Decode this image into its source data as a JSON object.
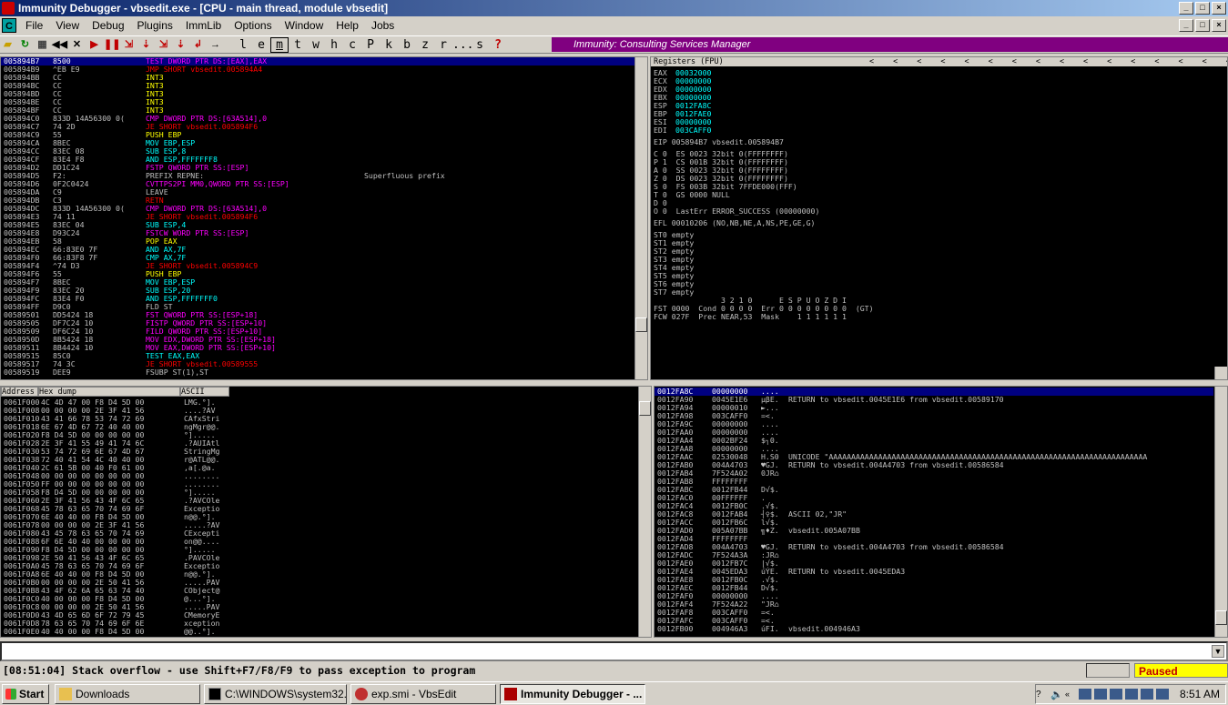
{
  "window": {
    "title": "Immunity Debugger - vbsedit.exe - [CPU - main thread, module vbsedit]"
  },
  "menu": [
    "File",
    "View",
    "Debug",
    "Plugins",
    "ImmLib",
    "Options",
    "Window",
    "Help",
    "Jobs"
  ],
  "toolbar_letters": [
    "l",
    "e",
    "m",
    "t",
    "w",
    "h",
    "c",
    "P",
    "k",
    "b",
    "z",
    "r",
    "...",
    "s",
    "?"
  ],
  "banner": "Immunity: Consulting Services Manager",
  "cpu": [
    [
      "005894B7",
      "8500",
      "TEST DWORD PTR DS:[EAX],EAX",
      "",
      1
    ],
    [
      "005894B9",
      "^EB E9",
      "JMP SHORT vbsedit.005894A4",
      "",
      0
    ],
    [
      "005894BB",
      "CC",
      "INT3",
      "",
      0
    ],
    [
      "005894BC",
      "CC",
      "INT3",
      "",
      0
    ],
    [
      "005894BD",
      "CC",
      "INT3",
      "",
      0
    ],
    [
      "005894BE",
      "CC",
      "INT3",
      "",
      0
    ],
    [
      "005894BF",
      "CC",
      "INT3",
      "",
      0
    ],
    [
      "005894C0",
      "833D 14A56300 0(",
      "CMP DWORD PTR DS:[63A514],0",
      "",
      0
    ],
    [
      "005894C7",
      "74 2D",
      "JE SHORT vbsedit.005894F6",
      "",
      0
    ],
    [
      "005894C9",
      "55",
      "PUSH EBP",
      "",
      0
    ],
    [
      "005894CA",
      "8BEC",
      "MOV EBP,ESP",
      "",
      0
    ],
    [
      "005894CC",
      "83EC 08",
      "SUB ESP,8",
      "",
      0
    ],
    [
      "005894CF",
      "83E4 F8",
      "AND ESP,FFFFFFF8",
      "",
      0
    ],
    [
      "005894D2",
      "DD1C24",
      "FSTP QWORD PTR SS:[ESP]",
      "",
      0
    ],
    [
      "005894D5",
      "F2:",
      "PREFIX REPNE:",
      "Superfluous prefix",
      0
    ],
    [
      "005894D6",
      "0F2C0424",
      "CVTTPS2PI MM0,QWORD PTR SS:[ESP]",
      "",
      0
    ],
    [
      "005894DA",
      "C9",
      "LEAVE",
      "",
      0
    ],
    [
      "005894DB",
      "C3",
      "RETN",
      "",
      0
    ],
    [
      "005894DC",
      "833D 14A56300 0(",
      "CMP DWORD PTR DS:[63A514],0",
      "",
      0
    ],
    [
      "005894E3",
      "74 11",
      "JE SHORT vbsedit.005894F6",
      "",
      0
    ],
    [
      "005894E5",
      "83EC 04",
      "SUB ESP,4",
      "",
      0
    ],
    [
      "005894E8",
      "D93C24",
      "FSTCW WORD PTR SS:[ESP]",
      "",
      0
    ],
    [
      "005894EB",
      "58",
      "POP EAX",
      "",
      0
    ],
    [
      "005894EC",
      "66:83E0 7F",
      "AND AX,7F",
      "",
      0
    ],
    [
      "005894F0",
      "66:83F8 7F",
      "CMP AX,7F",
      "",
      0
    ],
    [
      "005894F4",
      "^74 D3",
      "JE SHORT vbsedit.005894C9",
      "",
      0
    ],
    [
      "005894F6",
      "55",
      "PUSH EBP",
      "",
      0
    ],
    [
      "005894F7",
      "8BEC",
      "MOV EBP,ESP",
      "",
      0
    ],
    [
      "005894F9",
      "83EC 20",
      "SUB ESP,20",
      "",
      0
    ],
    [
      "005894FC",
      "83E4 F0",
      "AND ESP,FFFFFFF0",
      "",
      0
    ],
    [
      "005894FF",
      "D9C0",
      "FLD ST",
      "",
      0
    ],
    [
      "00589501",
      "DD5424 18",
      "FST QWORD PTR SS:[ESP+18]",
      "",
      0
    ],
    [
      "00589505",
      "DF7C24 10",
      "FISTP QWORD PTR SS:[ESP+10]",
      "",
      0
    ],
    [
      "00589509",
      "DF6C24 10",
      "FILD QWORD PTR SS:[ESP+10]",
      "",
      0
    ],
    [
      "0058950D",
      "8B5424 18",
      "MOV EDX,DWORD PTR SS:[ESP+18]",
      "",
      0
    ],
    [
      "00589511",
      "8B4424 10",
      "MOV EAX,DWORD PTR SS:[ESP+10]",
      "",
      0
    ],
    [
      "00589515",
      "85C0",
      "TEST EAX,EAX",
      "",
      0
    ],
    [
      "00589517",
      "74 3C",
      "JE SHORT vbsedit.00589555",
      "",
      0
    ],
    [
      "00589519",
      "DEE9",
      "FSUBP ST(1),ST",
      "",
      0
    ]
  ],
  "regs": {
    "title": "Registers (FPU)",
    "gp": [
      [
        "EAX",
        "00032000",
        ""
      ],
      [
        "ECX",
        "00000000",
        ""
      ],
      [
        "EDX",
        "00000000",
        ""
      ],
      [
        "EBX",
        "00000000",
        ""
      ],
      [
        "ESP",
        "0012FA8C",
        ""
      ],
      [
        "EBP",
        "0012FAE0",
        ""
      ],
      [
        "ESI",
        "00000000",
        ""
      ],
      [
        "EDI",
        "003CAFF0",
        ""
      ]
    ],
    "eip": "EIP 005894B7 vbsedit.005894B7",
    "flags": [
      "C 0  ES 0023 32bit 0(FFFFFFFF)",
      "P 1  CS 001B 32bit 0(FFFFFFFF)",
      "A 0  SS 0023 32bit 0(FFFFFFFF)",
      "Z 0  DS 0023 32bit 0(FFFFFFFF)",
      "S 0  FS 003B 32bit 7FFDE000(FFF)",
      "T 0  GS 0000 NULL",
      "D 0",
      "O 0  LastErr ERROR_SUCCESS (00000000)"
    ],
    "efl": "EFL 00010206 (NO,NB,NE,A,NS,PE,GE,G)",
    "fpu": [
      "ST0 empty",
      "ST1 empty",
      "ST2 empty",
      "ST3 empty",
      "ST4 empty",
      "ST5 empty",
      "ST6 empty",
      "ST7 empty"
    ],
    "fst_hdr": "               3 2 1 0      E S P U O Z D I",
    "fst": "FST 0000  Cond 0 0 0 0  Err 0 0 0 0 0 0 0 0  (GT)",
    "fcw": "FCW 027F  Prec NEAR,53  Mask    1 1 1 1 1 1"
  },
  "dump": {
    "headers": [
      "Address",
      "Hex dump",
      "ASCII"
    ],
    "rows": [
      [
        "0061F000",
        "4C 4D 47 00 F8 D4 5D 00",
        "LMG.°].",
        ""
      ],
      [
        "0061F008",
        "00 00 00 00 2E 3F 41 56",
        "....?AV",
        ""
      ],
      [
        "0061F010",
        "43 41 66 78 53 74 72 69",
        "CAfxStri",
        ""
      ],
      [
        "0061F018",
        "6E 67 4D 67 72 40 40 00",
        "ngMgr@@.",
        ""
      ],
      [
        "0061F020",
        "F8 D4 5D 00 00 00 00 00",
        "°].....",
        ""
      ],
      [
        "0061F028",
        "2E 3F 41 55 49 41 74 6C",
        ".?AUIAtl",
        ""
      ],
      [
        "0061F030",
        "53 74 72 69 6E 67 4D 67",
        "StringMg",
        ""
      ],
      [
        "0061F038",
        "72 40 41 54 4C 40 40 00",
        "r@ATL@@.",
        ""
      ],
      [
        "0061F040",
        "2C 61 5B 00 40 F0 61 00",
        ",a[.@a.",
        ""
      ],
      [
        "0061F048",
        "00 00 00 00 00 00 00 00",
        "........",
        ""
      ],
      [
        "0061F050",
        "FF 00 00 00 00 00 00 00",
        "........",
        ""
      ],
      [
        "0061F058",
        "F8 D4 5D 00 00 00 00 00",
        "°].....",
        ""
      ],
      [
        "0061F060",
        "2E 3F 41 56 43 4F 6C 65",
        ".?AVCOle",
        ""
      ],
      [
        "0061F068",
        "45 78 63 65 70 74 69 6F",
        "Exceptio",
        ""
      ],
      [
        "0061F070",
        "6E 40 40 00 F8 D4 5D 00",
        "n@@.°].",
        ""
      ],
      [
        "0061F078",
        "00 00 00 00 2E 3F 41 56",
        ".....?AV",
        ""
      ],
      [
        "0061F080",
        "43 45 78 63 65 70 74 69",
        "CExcepti",
        ""
      ],
      [
        "0061F088",
        "6F 6E 40 40 00 00 00 00",
        "on@@....",
        ""
      ],
      [
        "0061F090",
        "F8 D4 5D 00 00 00 00 00",
        "°].....",
        ""
      ],
      [
        "0061F098",
        "2E 50 41 56 43 4F 6C 65",
        ".PAVCOle",
        ""
      ],
      [
        "0061F0A0",
        "45 78 63 65 70 74 69 6F",
        "Exceptio",
        ""
      ],
      [
        "0061F0A8",
        "6E 40 40 00 F8 D4 5D 00",
        "n@@.°].",
        ""
      ],
      [
        "0061F0B0",
        "00 00 00 00 2E 50 41 56",
        ".....PAV",
        ""
      ],
      [
        "0061F0B8",
        "43 4F 62 6A 65 63 74 40",
        "CObject@",
        ""
      ],
      [
        "0061F0C0",
        "40 00 00 00 F8 D4 5D 00",
        "@...°].",
        ""
      ],
      [
        "0061F0C8",
        "00 00 00 00 2E 50 41 56",
        ".....PAV",
        ""
      ],
      [
        "0061F0D0",
        "43 4D 65 6D 6F 72 79 45",
        "CMemoryE",
        ""
      ],
      [
        "0061F0D8",
        "78 63 65 70 74 69 6F 6E",
        "xception",
        ""
      ],
      [
        "0061F0E0",
        "40 40 00 00 F8 D4 5D 00",
        "@@..°].",
        ""
      ]
    ]
  },
  "stack": [
    [
      "0012FA8C",
      "00000000",
      "....",
      "",
      1
    ],
    [
      "0012FA90",
      "0045E1E6",
      "µβE.",
      "RETURN to vbsedit.0045E1E6 from vbsedit.00589170",
      0
    ],
    [
      "0012FA94",
      "00000010",
      "►...",
      "",
      0
    ],
    [
      "0012FA98",
      "003CAFF0",
      "=<.",
      "",
      0
    ],
    [
      "0012FA9C",
      "00000000",
      "....",
      "",
      0
    ],
    [
      "0012FAA0",
      "00000000",
      "....",
      "",
      0
    ],
    [
      "0012FAA4",
      "0002BF24",
      "$┐0.",
      "",
      0
    ],
    [
      "0012FAA8",
      "00000000",
      "....",
      "",
      0
    ],
    [
      "0012FAAC",
      "02530048",
      "H.S0",
      "UNICODE \"AAAAAAAAAAAAAAAAAAAAAAAAAAAAAAAAAAAAAAAAAAAAAAAAAAAAAAAAAAAAAAAAAAAAAAA",
      0
    ],
    [
      "0012FAB0",
      "004A4703",
      "♥GJ.",
      "RETURN to vbsedit.004A4703 from vbsedit.00586584",
      0
    ],
    [
      "0012FAB4",
      "7F524A02",
      "0JR⌂",
      "",
      0
    ],
    [
      "0012FAB8",
      "FFFFFFFF",
      "",
      "",
      0
    ],
    [
      "0012FABC",
      "0012FB44",
      "D√$.",
      "",
      0
    ],
    [
      "0012FAC0",
      "00FFFFFF",
      ".",
      ""
    ],
    [
      "0012FAC4",
      "0012FB0C",
      ".√$.",
      "",
      0
    ],
    [
      "0012FAC8",
      "0012FAB4",
      "┤♀$.",
      "ASCII 02,\"JR\"",
      0
    ],
    [
      "0012FACC",
      "0012FB6C",
      "l√$.",
      "",
      0
    ],
    [
      "0012FAD0",
      "005A07BB",
      "╗♦Z.",
      "vbsedit.005A07BB",
      0
    ],
    [
      "0012FAD4",
      "FFFFFFFF",
      "",
      "",
      0
    ],
    [
      "0012FAD8",
      "004A4703",
      "♥GJ.",
      "RETURN to vbsedit.004A4703 from vbsedit.00586584",
      0
    ],
    [
      "0012FADC",
      "7F524A3A",
      ":JR⌂",
      "",
      0
    ],
    [
      "0012FAE0",
      "0012FB7C",
      "|√$.",
      "",
      0
    ],
    [
      "0012FAE4",
      "0045EDA3",
      "úÝE.",
      "RETURN to vbsedit.0045EDA3",
      0
    ],
    [
      "0012FAE8",
      "0012FB0C",
      ".√$.",
      "",
      0
    ],
    [
      "0012FAEC",
      "0012FB44",
      "D√$.",
      "",
      0
    ],
    [
      "0012FAF0",
      "00000000",
      "....",
      "",
      0
    ],
    [
      "0012FAF4",
      "7F524A22",
      "\"JR⌂",
      "",
      0
    ],
    [
      "0012FAF8",
      "003CAFF0",
      "=<.",
      "",
      0
    ],
    [
      "0012FAFC",
      "003CAFF0",
      "=<.",
      "",
      0
    ],
    [
      "0012FB00",
      "004946A3",
      "úFI.",
      "vbsedit.004946A3",
      0
    ]
  ],
  "status": {
    "message": "[08:51:04] Stack overflow - use Shift+F7/F8/F9 to pass exception to program",
    "state": "Paused"
  },
  "taskbar": {
    "start": "Start",
    "tasks": [
      "Downloads",
      "C:\\WINDOWS\\system32...",
      "exp.smi - VbsEdit",
      "Immunity Debugger - ..."
    ],
    "clock": "8:51 AM"
  },
  "colors": {
    "selection": "#000080",
    "jump": "#ff0000",
    "mem": "#ff00ff",
    "imm": "#00ffff",
    "stack": "#ffff00"
  }
}
